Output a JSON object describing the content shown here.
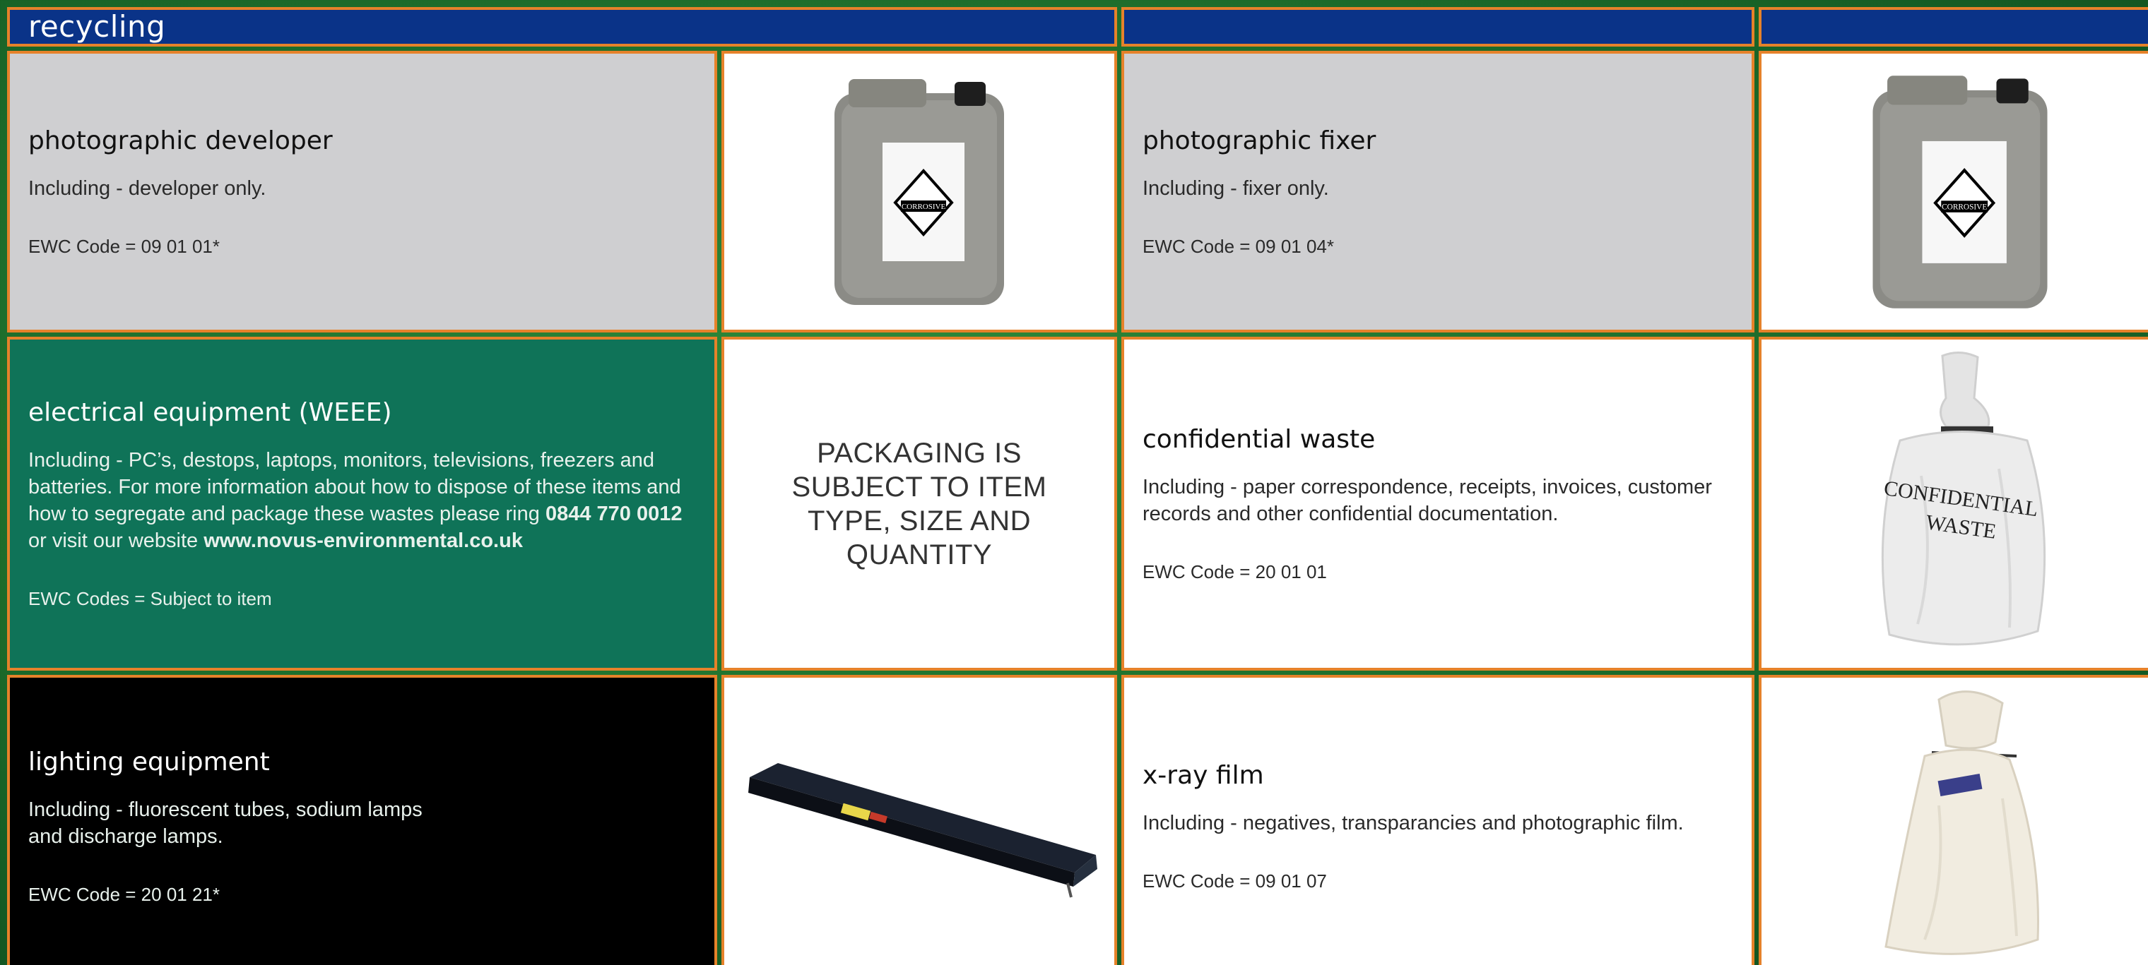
{
  "header": {
    "title": "recycling"
  },
  "items": [
    {
      "title": "photographic developer",
      "description": "Including - developer only.",
      "ewc": "EWC Code = 09 01 01*",
      "image": "container-icon",
      "label": "CORROSIVE"
    },
    {
      "title": "photographic fixer",
      "description": "Including - fixer only.",
      "ewc": "EWC Code = 09 01 04*",
      "image": "container-icon",
      "label": "CORROSIVE"
    },
    {
      "title": "electrical equipment (WEEE)",
      "description_prefix": "Including - PC’s, destops, laptops, monitors, televisions, freezers and batteries. For more information about how to dispose of these items and how to segregate and package these wastes please ring",
      "phone": "0844 770 0012",
      "description_mid": "or visit our website",
      "website": "www.novus-environmental.co.uk",
      "ewc": "EWC Codes = Subject to item",
      "packaging": "PACKAGING IS SUBJECT TO ITEM TYPE, SIZE AND QUANTITY"
    },
    {
      "title": "confidential waste",
      "description": "Including - paper correspondence, receipts, invoices, customer records and other confidential documentation.",
      "ewc": "EWC Code = 20 01 01",
      "image": "sack-icon",
      "bag_text_line1": "CONFIDENTIAL",
      "bag_text_line2": "WASTE"
    },
    {
      "title": "lighting equipment",
      "description": "Including - fluorescent tubes, sodium lamps and discharge lamps.",
      "ewc": "EWC Code = 20 01 21*",
      "image": "tube-box-icon"
    },
    {
      "title": "x-ray film",
      "description": "Including - negatives, transparancies and photographic film.",
      "ewc": "EWC Code = 09 01 07",
      "image": "sack-icon"
    }
  ],
  "colors": {
    "header": "#0a3388",
    "border": "#e6822a",
    "grey": "#cfcfd1",
    "green": "#0f7358",
    "black": "#000000"
  }
}
